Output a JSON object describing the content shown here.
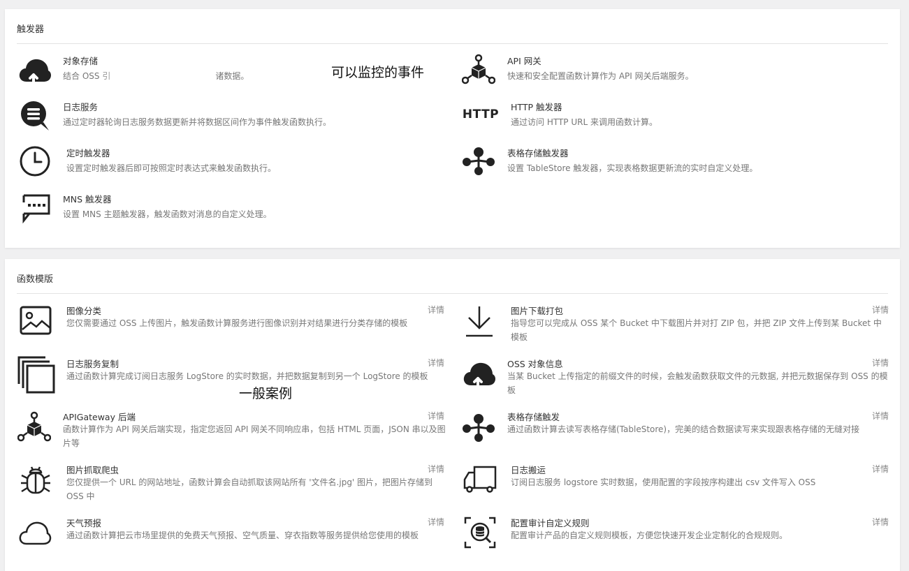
{
  "triggers": {
    "title": "触发器",
    "items": [
      {
        "title": "对象存储",
        "desc_prefix": "结合 OSS ",
        "desc_suffix": "诸数据。",
        "icon": "cloud-upload-icon"
      },
      {
        "title": "API 网关",
        "desc": "快速和安全配置函数计算作为 API 网关后端服务。",
        "icon": "api-gateway-icon"
      },
      {
        "title": "日志服务",
        "desc": "通过定时器轮询日志服务数据更新并将数据区间作为事件触发函数执行。",
        "icon": "log-search-icon"
      },
      {
        "title": "HTTP 触发器",
        "desc": "通过访问 HTTP URL 来调用函数计算。",
        "icon": "http-icon",
        "icon_text": "HTTP"
      },
      {
        "title": "定时触发器",
        "desc": "设置定时触发器后即可按照定时表达式来触发函数执行。",
        "icon": "clock-icon"
      },
      {
        "title": "表格存储触发器",
        "desc": "设置 TableStore 触发器，实现表格数据更新流的实时自定义处理。",
        "icon": "tablestore-icon"
      },
      {
        "title": "MNS 触发器",
        "desc": "设置 MNS 主题触发器，触发函数对消息的自定义处理。",
        "icon": "message-icon"
      }
    ]
  },
  "templates": {
    "title": "函数模版",
    "detail_label": "详情",
    "items": [
      {
        "title": "图像分类",
        "desc": "您仅需要通过 OSS 上传图片，触发函数计算服务进行图像识别并对结果进行分类存储的模板",
        "icon": "image-icon"
      },
      {
        "title": "图片下载打包",
        "desc": "指导您可以完成从 OSS 某个 Bucket 中下载图片并对打 ZIP 包，并把 ZIP 文件上传到某 Bucket 中模板",
        "icon": "download-icon"
      },
      {
        "title": "日志服务复制",
        "desc": "通过函数计算完成订阅日志服务 LogStore 的实时数据，并把数据复制到另一个 LogStore 的模板",
        "icon": "copy-icon"
      },
      {
        "title": "OSS 对象信息",
        "desc": "当某 Bucket 上传指定的前缀文件的时候，会触发函数获取文件的元数据, 并把元数据保存到 OSS 的模板",
        "icon": "cloud-upload-icon"
      },
      {
        "title": "APIGateway 后端",
        "desc": "函数计算作为 API 网关后端实现，指定您返回 API 网关不同响应串，包括 HTML 页面，JSON 串以及图片等",
        "icon": "api-gateway-icon"
      },
      {
        "title": "表格存储触发",
        "desc": "通过函数计算去读写表格存储(TableStore)，完美的结合数据读写来实现跟表格存储的无缝对接",
        "icon": "tablestore-icon"
      },
      {
        "title": "图片抓取爬虫",
        "desc": "您仅提供一个 URL 的网站地址，函数计算会自动抓取该网站所有 '文件名.jpg' 图片，把图片存储到 OSS 中",
        "icon": "bug-icon"
      },
      {
        "title": "日志搬运",
        "desc": "订阅日志服务 logstore 实时数据，使用配置的字段按序构建出 csv 文件写入 OSS",
        "icon": "truck-icon"
      },
      {
        "title": "天气预报",
        "desc": "通过函数计算把云市场里提供的免费天气预报、空气质量、穿衣指数等服务提供给您使用的模板",
        "icon": "cloud-icon"
      },
      {
        "title": "配置审计自定义规则",
        "desc": "配置审计产品的自定义规则模板，方便您快速开发企业定制化的合规规则。",
        "icon": "audit-icon"
      }
    ]
  },
  "annotations": {
    "monitor_events": "可以监控的事件",
    "general_cases": "一般案例"
  }
}
